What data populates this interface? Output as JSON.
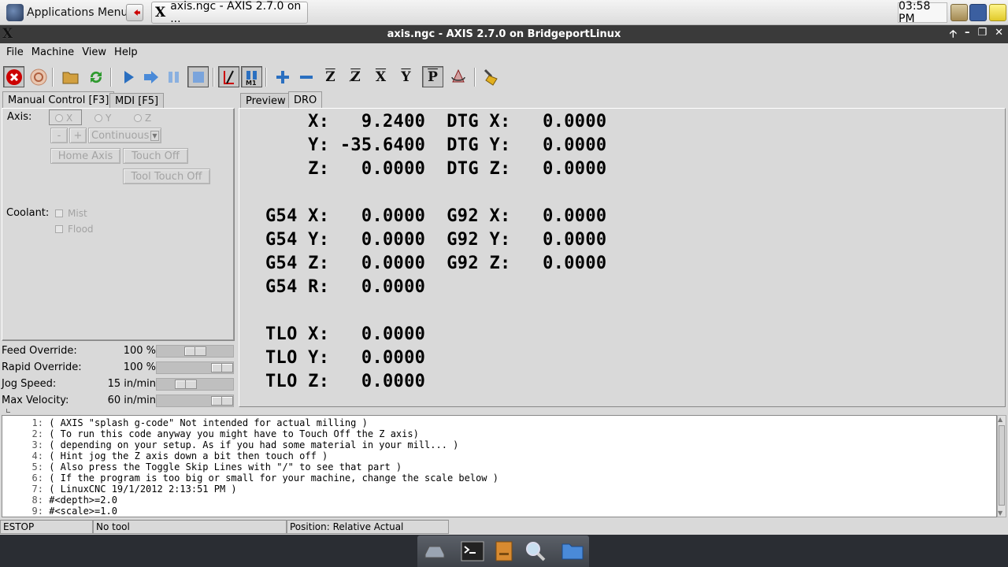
{
  "taskbar": {
    "app_menu_label": "Applications Menu",
    "task_title": "axis.ngc - AXIS 2.7.0 on ...",
    "clock": "03:58 PM"
  },
  "window": {
    "title": "axis.ngc - AXIS 2.7.0 on BridgeportLinux"
  },
  "menu": {
    "file": "File",
    "machine": "Machine",
    "view": "View",
    "help": "Help"
  },
  "left_tabs": {
    "manual": "Manual Control [F3]",
    "mdi": "MDI [F5]"
  },
  "right_tabs": {
    "preview": "Preview",
    "dro": "DRO"
  },
  "manual": {
    "axis_label": "Axis:",
    "axes": [
      "X",
      "Y",
      "Z"
    ],
    "minus": "-",
    "plus": "+",
    "jog_mode": "Continuous",
    "home_axis": "Home Axis",
    "touch_off": "Touch Off",
    "tool_touch_off": "Tool Touch Off",
    "coolant_label": "Coolant:",
    "mist": "Mist",
    "flood": "Flood"
  },
  "sliders": [
    {
      "name": "Feed Override:",
      "value": "100 %",
      "position": 0.5
    },
    {
      "name": "Rapid Override:",
      "value": "100 %",
      "position": 1.0
    },
    {
      "name": "Jog Speed:",
      "value": "15 in/min",
      "position": 0.33
    },
    {
      "name": "Max Velocity:",
      "value": "60 in/min",
      "position": 1.0
    }
  ],
  "dro": [
    "    X:   9.2400  DTG X:   0.0000",
    "    Y: -35.6400  DTG Y:   0.0000",
    "    Z:   0.0000  DTG Z:   0.0000",
    "",
    "G54 X:   0.0000  G92 X:   0.0000",
    "G54 Y:   0.0000  G92 Y:   0.0000",
    "G54 Z:   0.0000  G92 Z:   0.0000",
    "G54 R:   0.0000",
    "",
    "TLO X:   0.0000",
    "TLO Y:   0.0000",
    "TLO Z:   0.0000"
  ],
  "gcode": [
    {
      "n": "1:",
      "text": "( AXIS \"splash g-code\" Not intended for actual milling )"
    },
    {
      "n": "2:",
      "text": "( To run this code anyway you might have to Touch Off the Z axis)"
    },
    {
      "n": "3:",
      "text": "( depending on your setup. As if you had some material in your mill... )"
    },
    {
      "n": "4:",
      "text": "( Hint jog the Z axis down a bit then touch off )"
    },
    {
      "n": "5:",
      "text": "( Also press the Toggle Skip Lines with \"/\" to see that part )"
    },
    {
      "n": "6:",
      "text": "( If the program is too big or small for your machine, change the scale below )"
    },
    {
      "n": "7:",
      "text": "( LinuxCNC 19/1/2012 2:13:51 PM )"
    },
    {
      "n": "8:",
      "text": "#<depth>=2.0"
    },
    {
      "n": "9:",
      "text": "#<scale>=1.0"
    }
  ],
  "status": {
    "state": "ESTOP",
    "tool": "No tool",
    "position": "Position: Relative Actual"
  },
  "toolbar_icons": [
    "estop-icon",
    "power-icon",
    "open-icon",
    "reload-icon",
    "run-icon",
    "step-icon",
    "pause-icon",
    "stop-icon",
    "block-delete-icon",
    "optional-stop-icon",
    "zoom-in-icon",
    "zoom-out-icon",
    "view-z-icon",
    "view-z2-icon",
    "view-x-icon",
    "view-y-icon",
    "view-p-icon",
    "rotate-icon",
    "clear-plot-icon"
  ],
  "colors": {
    "estop_red": "#cc0000",
    "run_blue": "#2a6fc0",
    "reload_green": "#2f9a2f",
    "title_bg": "#3a3a3a"
  }
}
